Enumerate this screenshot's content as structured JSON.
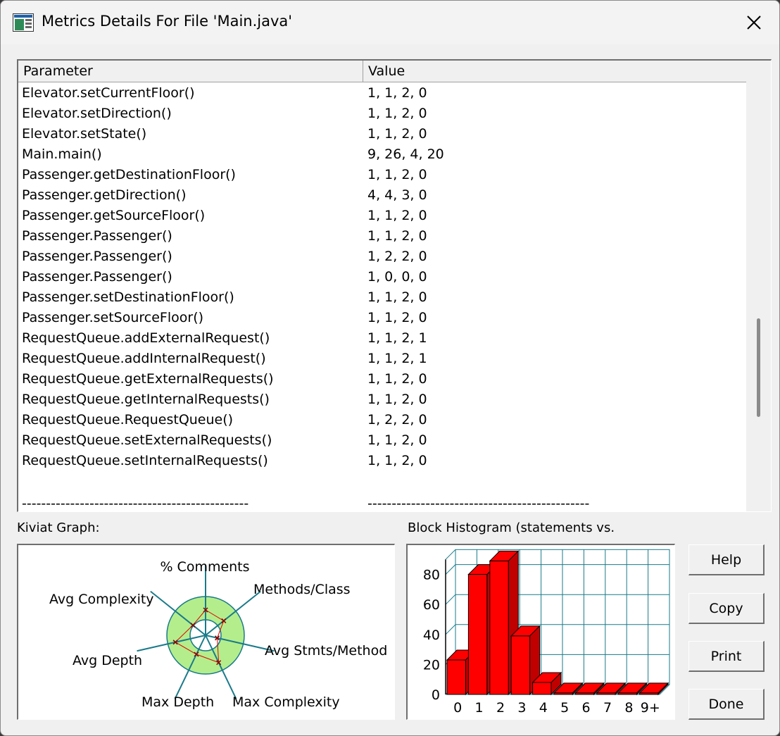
{
  "window": {
    "title": "Metrics Details For File 'Main.java'"
  },
  "table": {
    "headers": {
      "parameter": "Parameter",
      "value": "Value"
    },
    "rows": [
      {
        "param": "Elevator.setCurrentFloor()",
        "value": "1, 1, 2, 0"
      },
      {
        "param": "Elevator.setDirection()",
        "value": "1, 1, 2, 0"
      },
      {
        "param": "Elevator.setState()",
        "value": "1, 1, 2, 0"
      },
      {
        "param": "Main.main()",
        "value": "9, 26, 4, 20"
      },
      {
        "param": "Passenger.getDestinationFloor()",
        "value": "1, 1, 2, 0"
      },
      {
        "param": "Passenger.getDirection()",
        "value": "4, 4, 3, 0"
      },
      {
        "param": "Passenger.getSourceFloor()",
        "value": "1, 1, 2, 0"
      },
      {
        "param": "Passenger.Passenger()",
        "value": "1, 1, 2, 0"
      },
      {
        "param": "Passenger.Passenger()",
        "value": "1, 2, 2, 0"
      },
      {
        "param": "Passenger.Passenger()",
        "value": "1, 0, 0, 0"
      },
      {
        "param": "Passenger.setDestinationFloor()",
        "value": "1, 1, 2, 0"
      },
      {
        "param": "Passenger.setSourceFloor()",
        "value": "1, 1, 2, 0"
      },
      {
        "param": "RequestQueue.addExternalRequest()",
        "value": "1, 1, 2, 1"
      },
      {
        "param": "RequestQueue.addInternalRequest()",
        "value": "1, 1, 2, 1"
      },
      {
        "param": "RequestQueue.getExternalRequests()",
        "value": "1, 1, 2, 0"
      },
      {
        "param": "RequestQueue.getInternalRequests()",
        "value": "1, 1, 2, 0"
      },
      {
        "param": "RequestQueue.RequestQueue()",
        "value": "1, 2, 2, 0"
      },
      {
        "param": "RequestQueue.setExternalRequests()",
        "value": "1, 1, 2, 0"
      },
      {
        "param": "RequestQueue.setInternalRequests()",
        "value": "1, 1, 2, 0"
      },
      {
        "param": "",
        "value": ""
      }
    ],
    "separator": {
      "param": "-----------------------------------------------",
      "value": "----------------------------------------------"
    }
  },
  "kiviat": {
    "label": "Kiviat Graph:",
    "axes": [
      "% Comments",
      "Methods/Class",
      "Avg Stmts/Method",
      "Max Complexity",
      "Max Depth",
      "Avg Depth",
      "Avg Complexity"
    ],
    "colors": {
      "ring": "#b4ee8c",
      "plot": "#e00000",
      "axis": "#1a7a8a"
    }
  },
  "histogram": {
    "label": "Block Histogram (statements vs.",
    "colors": {
      "bar": "#ff0000",
      "grid": "#1a7a8a"
    }
  },
  "chart_data": {
    "type": "bar",
    "title": "Block Histogram (statements vs.",
    "categories": [
      "0",
      "1",
      "2",
      "3",
      "4",
      "5",
      "6",
      "7",
      "8",
      "9+"
    ],
    "values": [
      23,
      80,
      89,
      39,
      8,
      1,
      1,
      1,
      1,
      1
    ],
    "yticks": [
      0,
      20,
      40,
      60,
      80
    ],
    "ylim": [
      0,
      90
    ],
    "grid": true
  },
  "buttons": {
    "help": "Help",
    "copy": "Copy",
    "print": "Print",
    "done": "Done"
  }
}
